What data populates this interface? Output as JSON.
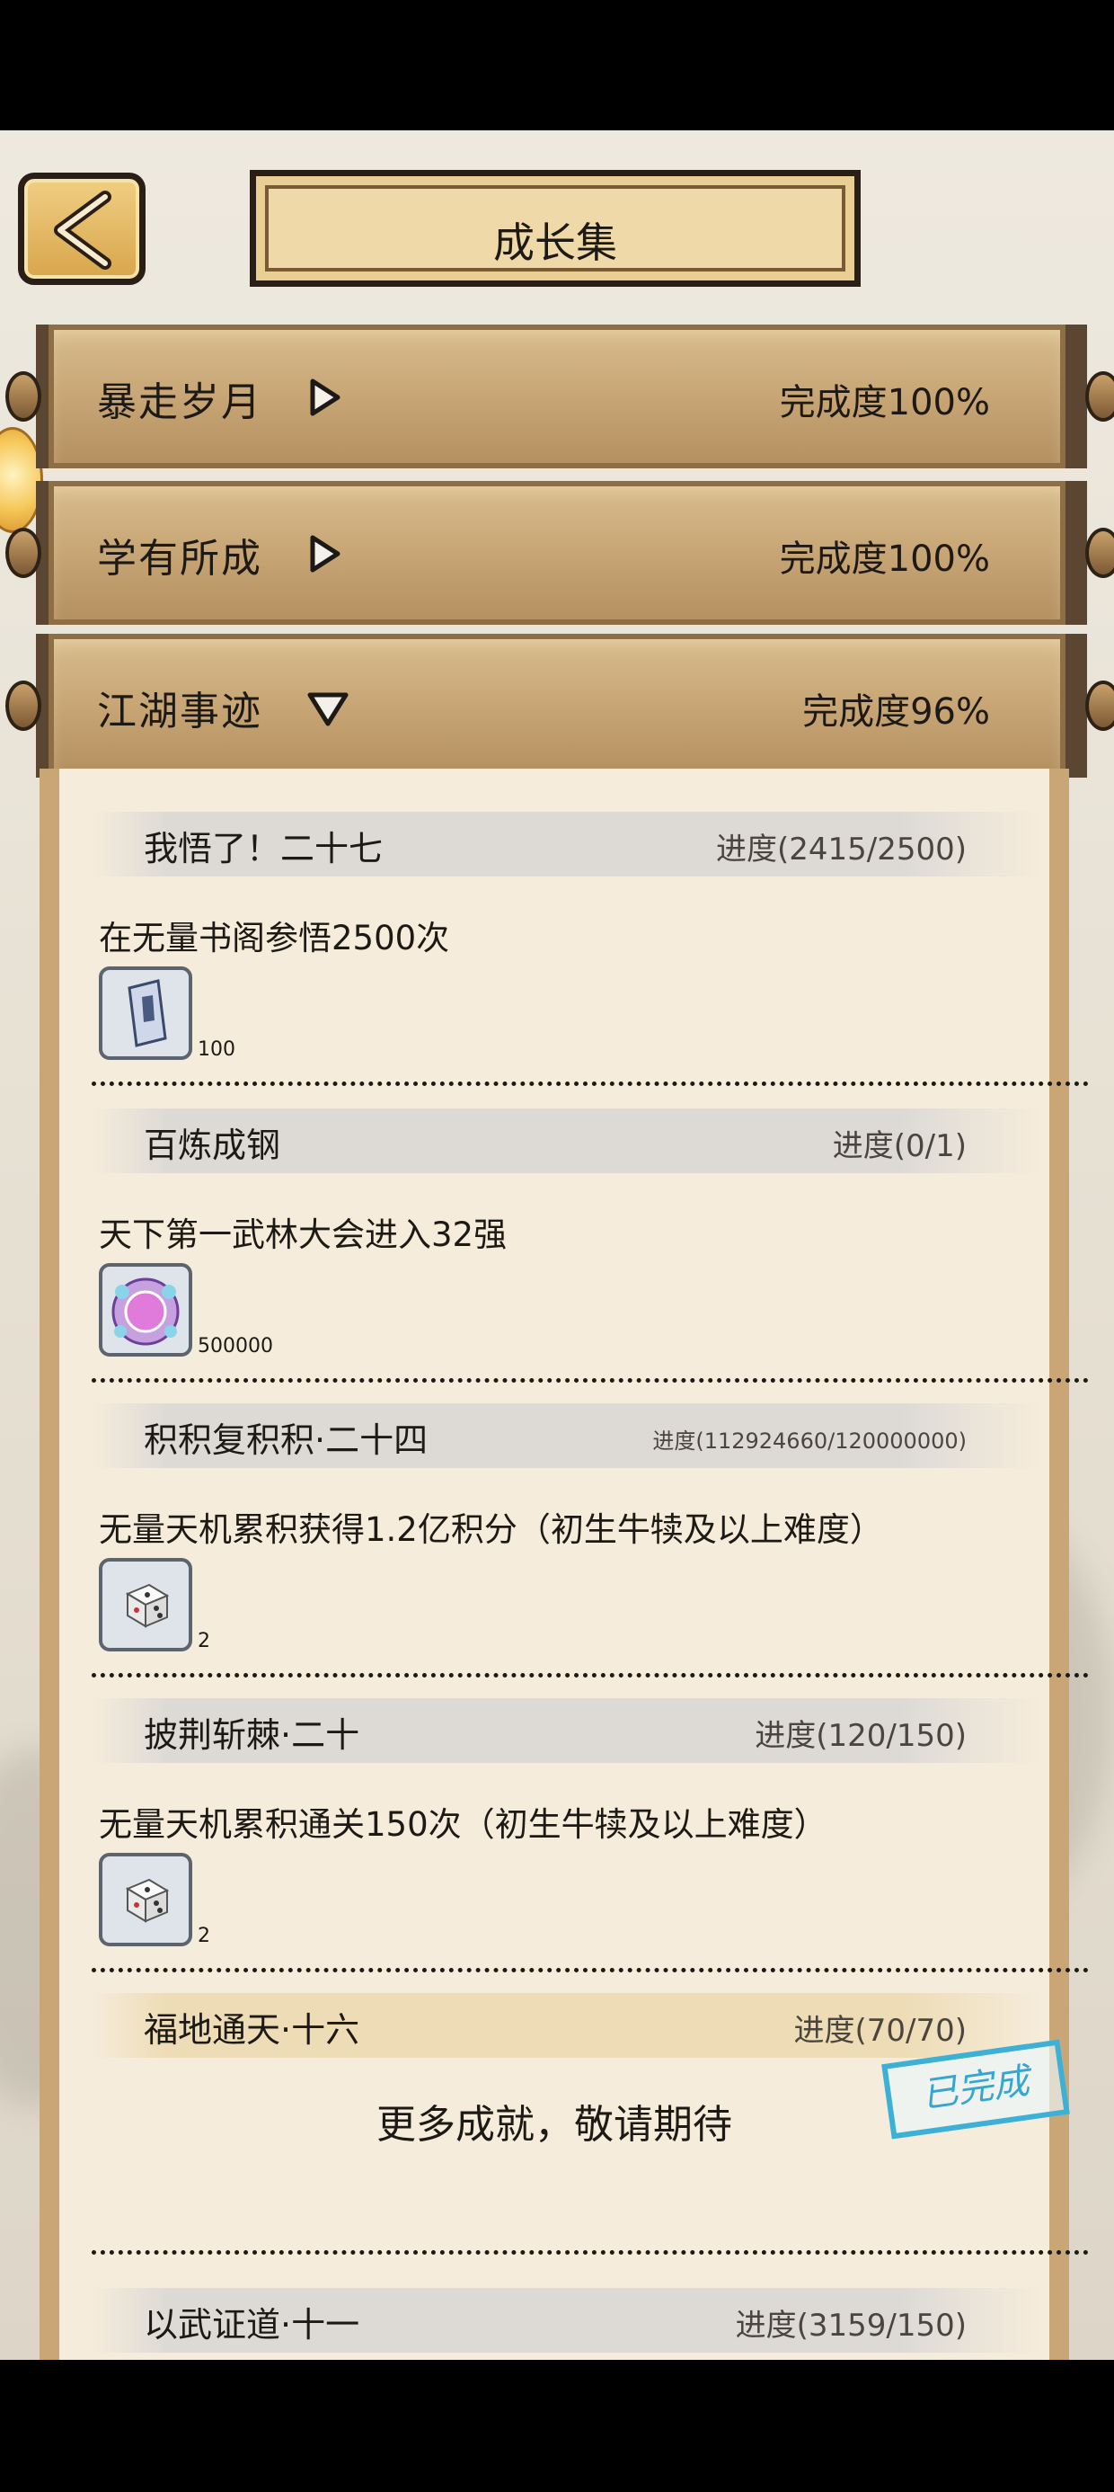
{
  "header": {
    "title": "成长集"
  },
  "categories": [
    {
      "name": "暴走岁月",
      "progress": "完成度100%",
      "expanded": false
    },
    {
      "name": "学有所成",
      "progress": "完成度100%",
      "expanded": false
    },
    {
      "name": "江湖事迹",
      "progress": "完成度96%",
      "expanded": true
    }
  ],
  "achievements": [
    {
      "title": "我悟了！二十七",
      "progress": "进度(2415/2500)",
      "desc": "在无量书阁参悟2500次",
      "reward_icon": "scroll-token-icon",
      "reward_count": "100"
    },
    {
      "title": "百炼成钢",
      "progress": "进度(0/1)",
      "desc": "天下第一武林大会进入32强",
      "reward_icon": "purple-orb-icon",
      "reward_count": "500000"
    },
    {
      "title": "积积复积积·二十四",
      "progress": "进度(112924660/120000000)",
      "desc": "无量天机累积获得1.2亿积分（初生牛犊及以上难度）",
      "reward_icon": "dice-icon",
      "reward_count": "2"
    },
    {
      "title": "披荆斩棘·二十",
      "progress": "进度(120/150)",
      "desc": "无量天机累积通关150次（初生牛犊及以上难度）",
      "reward_icon": "dice-icon",
      "reward_count": "2"
    },
    {
      "title": "福地通天·十六",
      "progress": "进度(70/70)",
      "completed": true
    },
    {
      "title": "以武证道·十一",
      "progress": "进度(3159/150)"
    }
  ],
  "more_text": "更多成就，敬请期待",
  "stamp_text": "已完成",
  "colors": {
    "parchment": "#f6ecdb",
    "bar_wood": "#c6a373",
    "stamp_blue": "#36a6cf"
  }
}
